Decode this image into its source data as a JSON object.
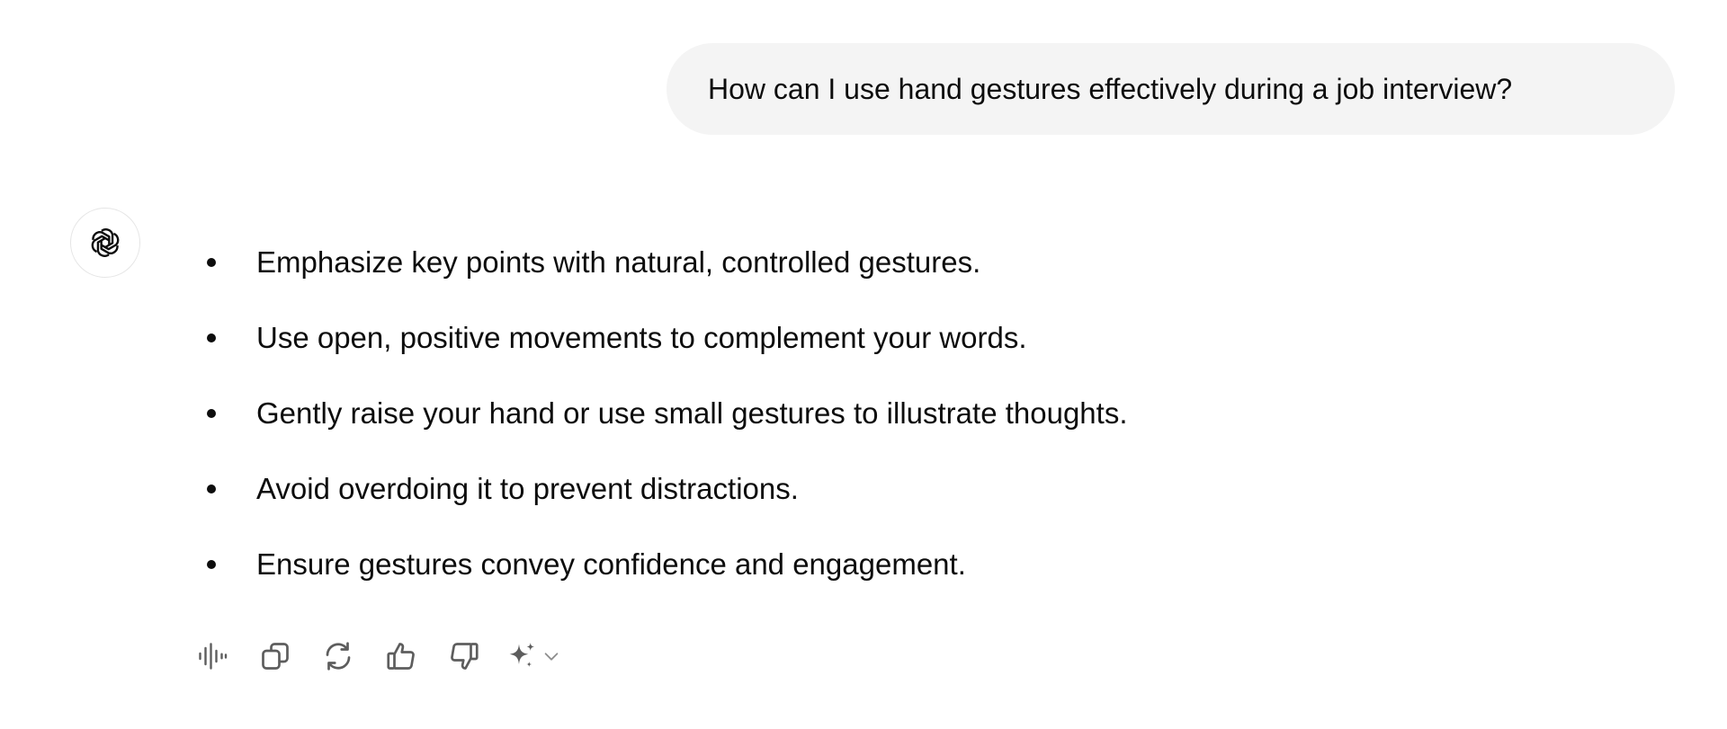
{
  "conversation": {
    "user_message": "How can I use hand gestures effectively during a job interview?",
    "assistant": {
      "avatar_icon": "openai-logo-icon",
      "bullets": [
        "Emphasize key points with natural, controlled gestures.",
        "Use open, positive movements to complement your words.",
        "Gently raise your hand or use small gestures to illustrate thoughts.",
        "Avoid overdoing it to prevent distractions.",
        "Ensure gestures convey confidence and engagement."
      ]
    },
    "actions": [
      {
        "icon": "read-aloud-icon"
      },
      {
        "icon": "copy-icon"
      },
      {
        "icon": "regenerate-icon"
      },
      {
        "icon": "thumbs-up-icon"
      },
      {
        "icon": "thumbs-down-icon"
      },
      {
        "icon": "sparkle-icon"
      }
    ]
  },
  "colors": {
    "user_bubble_bg": "#f4f4f4",
    "text": "#0d0d0d",
    "icon": "#5d5d5d",
    "avatar_border": "#e5e5e5"
  }
}
